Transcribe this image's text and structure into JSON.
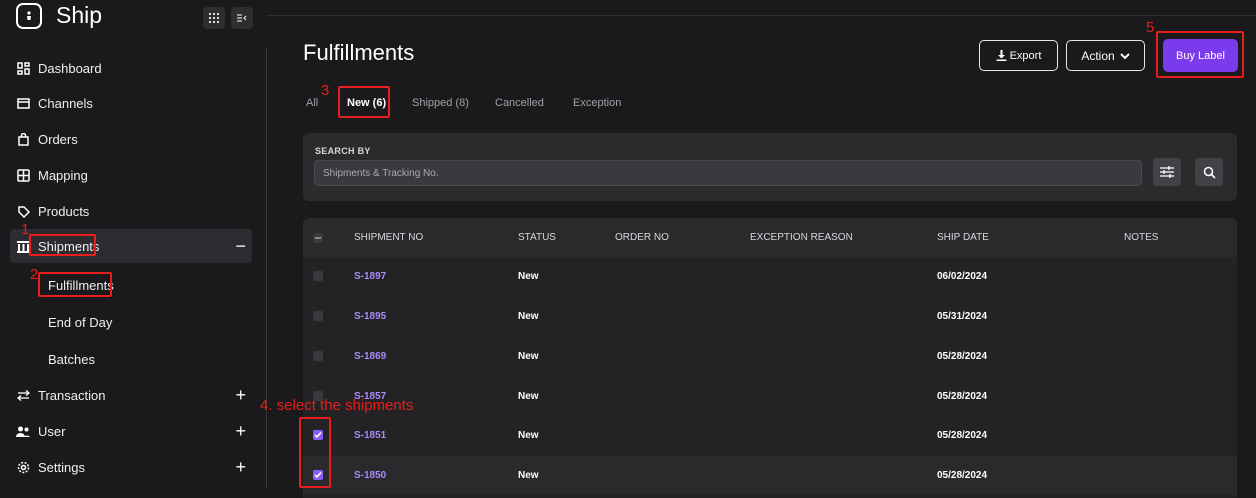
{
  "brand": {
    "title": "Ship"
  },
  "sidebar": {
    "items": [
      {
        "label": "Dashboard",
        "icon": "grid-icon"
      },
      {
        "label": "Channels",
        "icon": "store-icon"
      },
      {
        "label": "Orders",
        "icon": "bag-icon"
      },
      {
        "label": "Mapping",
        "icon": "map-icon"
      },
      {
        "label": "Products",
        "icon": "tag-icon"
      },
      {
        "label": "Shipments",
        "icon": "building-icon",
        "toggle": "−"
      },
      {
        "label": "Transaction",
        "icon": "swap-icon",
        "toggle": "+"
      },
      {
        "label": "User",
        "icon": "users-icon",
        "toggle": "+"
      },
      {
        "label": "Settings",
        "icon": "gear-icon",
        "toggle": "+"
      }
    ],
    "subitems": [
      {
        "label": "Fulfillments"
      },
      {
        "label": "End of Day"
      },
      {
        "label": "Batches"
      }
    ]
  },
  "header": {
    "title": "Fulfillments",
    "export_label": "Export",
    "action_label": "Action",
    "buy_label": "Buy Label"
  },
  "tabs": [
    {
      "label": "All"
    },
    {
      "label": "New (6)"
    },
    {
      "label": "Shipped (8)"
    },
    {
      "label": "Cancelled"
    },
    {
      "label": "Exception"
    }
  ],
  "search": {
    "label": "SEARCH BY",
    "placeholder": "Shipments & Tracking No."
  },
  "table": {
    "columns": [
      "SHIPMENT NO",
      "STATUS",
      "ORDER NO",
      "EXCEPTION REASON",
      "SHIP DATE",
      "NOTES"
    ],
    "rows": [
      {
        "shipment": "S-1897",
        "status": "New",
        "order": "",
        "exception": "",
        "date": "06/02/2024",
        "notes": "",
        "checked": false
      },
      {
        "shipment": "S-1895",
        "status": "New",
        "order": "",
        "exception": "",
        "date": "05/31/2024",
        "notes": "",
        "checked": false
      },
      {
        "shipment": "S-1869",
        "status": "New",
        "order": "",
        "exception": "",
        "date": "05/28/2024",
        "notes": "",
        "checked": false
      },
      {
        "shipment": "S-1857",
        "status": "New",
        "order": "",
        "exception": "",
        "date": "05/28/2024",
        "notes": "",
        "checked": false
      },
      {
        "shipment": "S-1851",
        "status": "New",
        "order": "",
        "exception": "",
        "date": "05/28/2024",
        "notes": "",
        "checked": true
      },
      {
        "shipment": "S-1850",
        "status": "New",
        "order": "",
        "exception": "",
        "date": "05/28/2024",
        "notes": "",
        "checked": true
      }
    ]
  },
  "annotations": {
    "n1": "1",
    "n2": "2",
    "n3": "3",
    "n4": "4. select the shipments",
    "n5": "5"
  },
  "colors": {
    "accent": "#7c3aed",
    "link": "#a78bfa",
    "annotation": "#e81d1d",
    "background": "#1a1a1c"
  }
}
